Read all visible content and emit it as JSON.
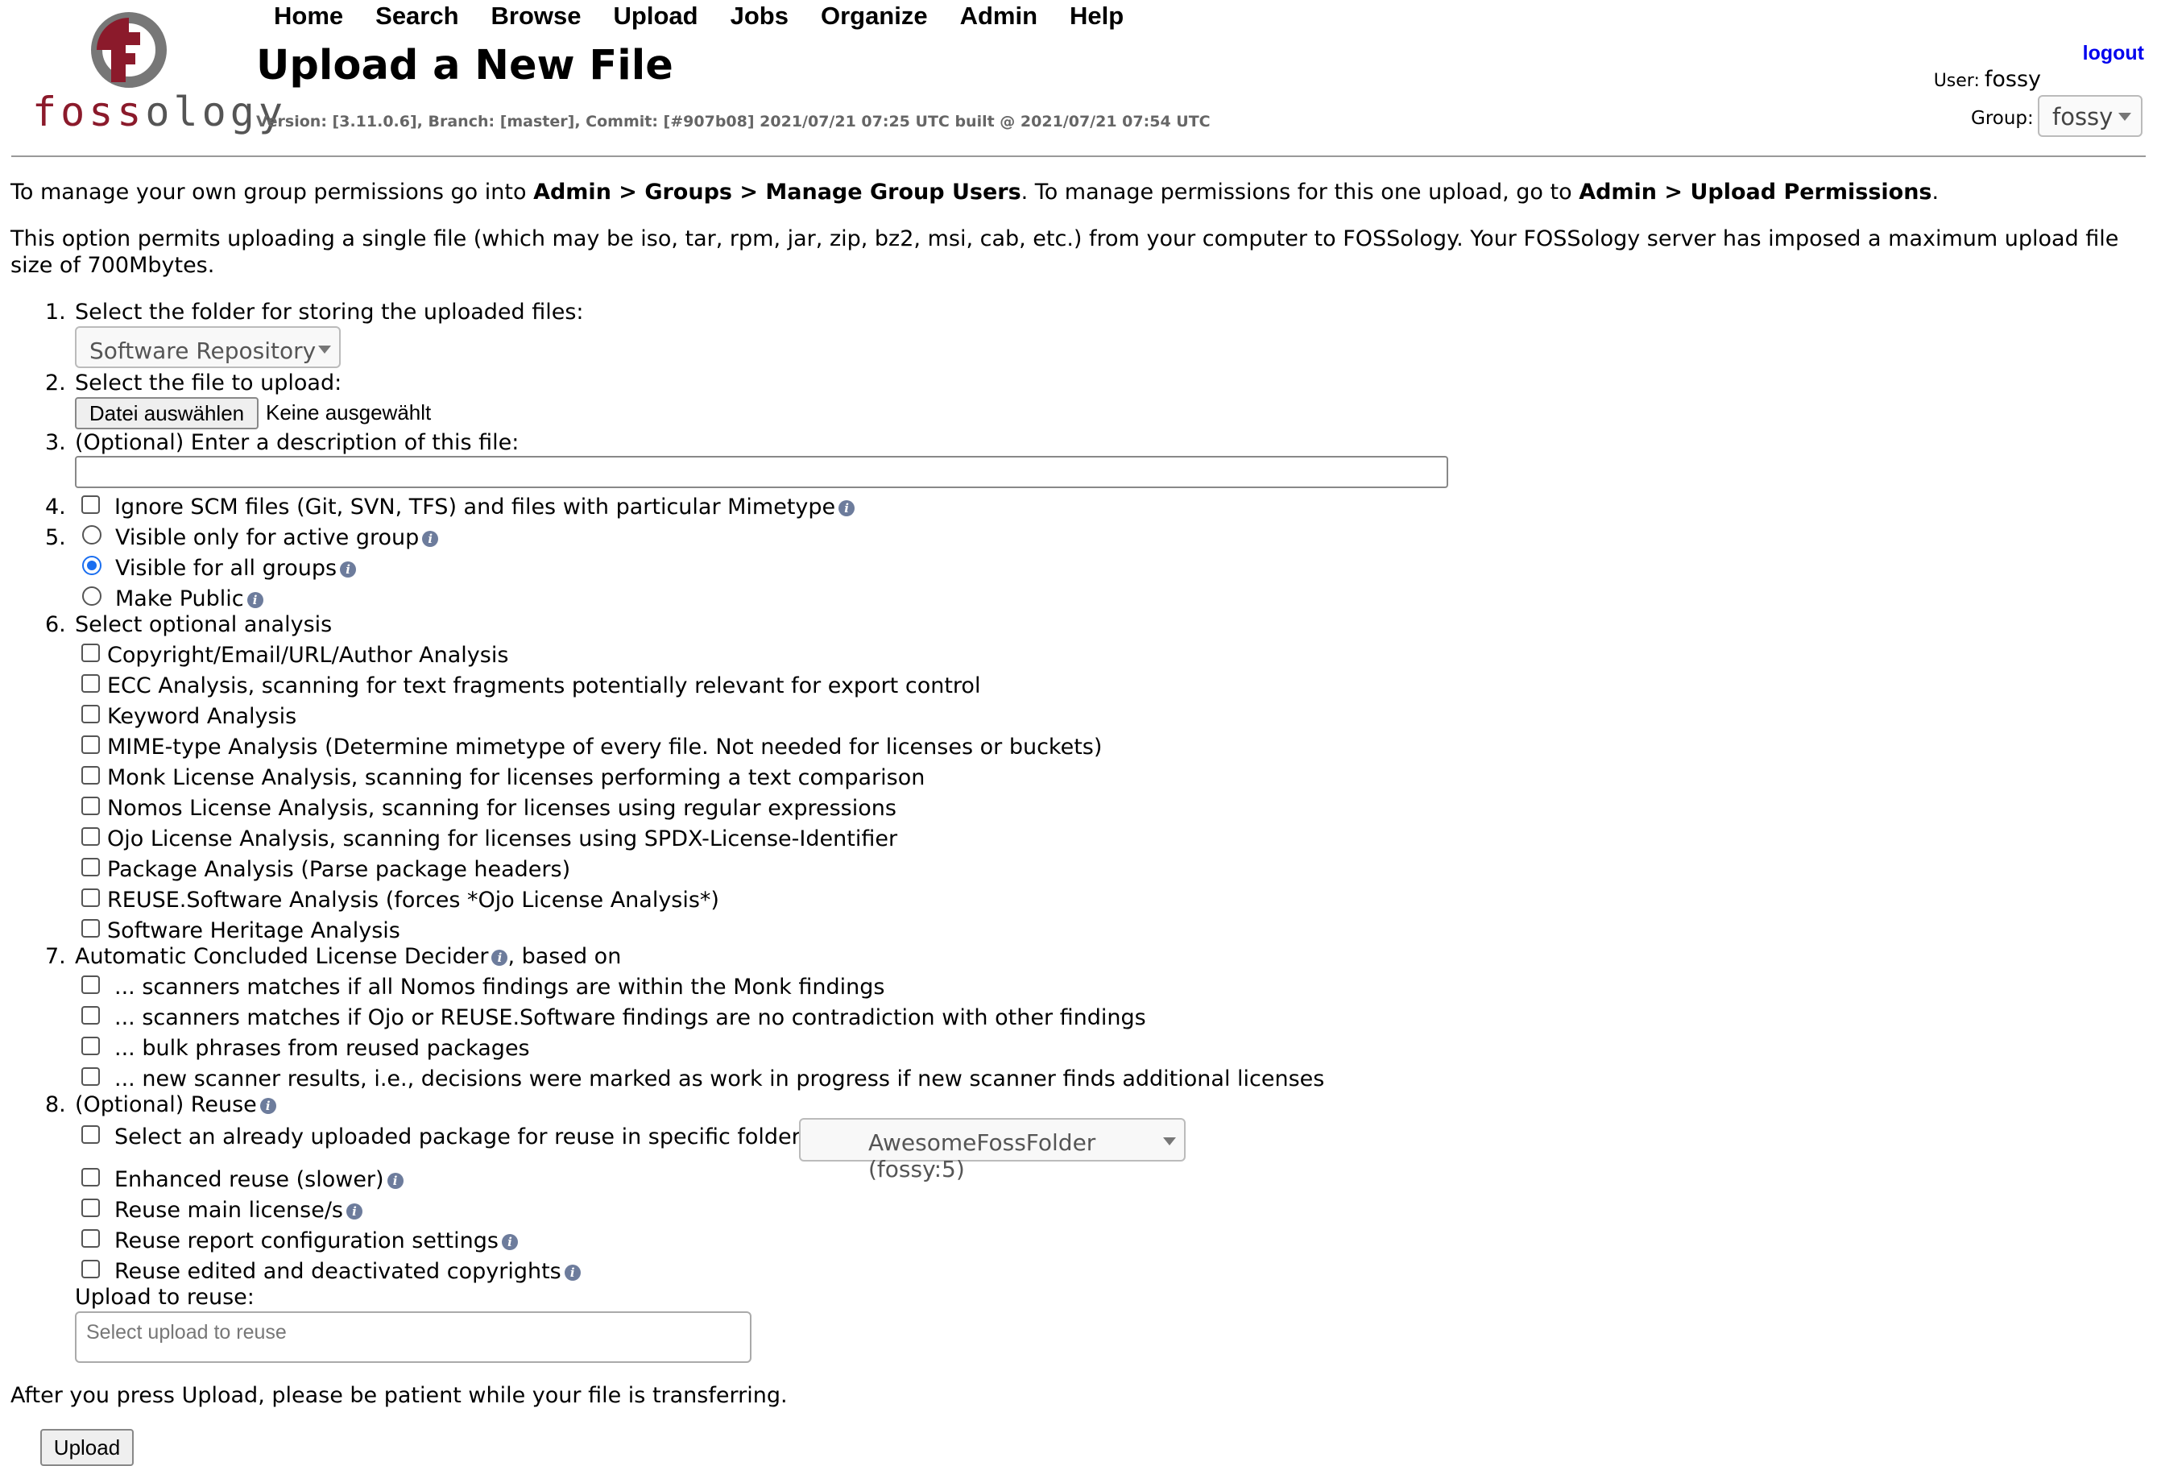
{
  "logo": {
    "text_red": "foss",
    "text_gray": "ology"
  },
  "nav": [
    "Home",
    "Search",
    "Browse",
    "Upload",
    "Jobs",
    "Organize",
    "Admin",
    "Help"
  ],
  "page_title": "Upload a New File",
  "version": "Version: [3.11.0.6], Branch: [master], Commit: [#907b08] 2021/07/21 07:25 UTC built @ 2021/07/21 07:54 UTC",
  "header": {
    "logout": "logout",
    "user_label": "User:",
    "user_name": "fossy",
    "group_label": "Group:",
    "group_value": "fossy"
  },
  "intro": {
    "p1_a": "To manage your own group permissions go into ",
    "p1_b": "Admin > Groups > Manage Group Users",
    "p1_c": ". To manage permissions for this one upload, go to ",
    "p1_d": "Admin > Upload Permissions",
    "p1_e": ".",
    "p2_line1": "This option permits uploading a single file (which may be iso, tar, rpm, jar, zip, bz2, msi, cab, etc.) from your computer to FOSSology. Your FOSSology server has imposed a maximum upload file",
    "p2_line2": "size of 700Mbytes."
  },
  "steps": {
    "s1_num": "1.",
    "s1_label": "Select the folder for storing the uploaded files:",
    "s1_folder": "Software Repository",
    "s2_num": "2.",
    "s2_label": "Select the file to upload:",
    "s2_button": "Datei auswählen",
    "s2_status": "Keine ausgewählt",
    "s3_num": "3.",
    "s3_label": "(Optional) Enter a description of this file:",
    "s3_value": "",
    "s4_num": "4.",
    "s4_label": "Ignore SCM files (Git, SVN, TFS) and files with particular Mimetype",
    "s5_num": "5.",
    "s5_opt1": "Visible only for active group",
    "s5_opt2": "Visible for all groups",
    "s5_opt3": "Make Public",
    "s5_selected": "Visible for all groups",
    "s6_num": "6.",
    "s6_label": "Select optional analysis",
    "s6_items": [
      "Copyright/Email/URL/Author Analysis",
      "ECC Analysis, scanning for text fragments potentially relevant for export control",
      "Keyword Analysis",
      "MIME-type Analysis (Determine mimetype of every file. Not needed for licenses or buckets)",
      "Monk License Analysis, scanning for licenses performing a text comparison",
      "Nomos License Analysis, scanning for licenses using regular expressions",
      "Ojo License Analysis, scanning for licenses using SPDX-License-Identifier",
      "Package Analysis (Parse package headers)",
      "REUSE.Software Analysis (forces *Ojo License Analysis*)",
      "Software Heritage Analysis"
    ],
    "s7_num": "7.",
    "s7_label_a": "Automatic Concluded License Decider",
    "s7_label_b": ", based on",
    "s7_items": [
      "... scanners matches if all Nomos findings are within the Monk findings",
      "... scanners matches if Ojo or REUSE.Software findings are no contradiction with other findings",
      "... bulk phrases from reused packages",
      "... new scanner results, i.e., decisions were marked as work in progress if new scanner finds additional licenses"
    ],
    "s8_num": "8.",
    "s8_label": "(Optional) Reuse",
    "s8_reuse_folder_label": "Select an already uploaded package for reuse in specific folder",
    "s8_reuse_folder": "AwesomeFossFolder (fossy:5)",
    "s8_enhanced": "Enhanced reuse (slower)",
    "s8_main": "Reuse main license/s",
    "s8_report": "Reuse report configuration settings",
    "s8_copyrights": "Reuse edited and deactivated copyrights",
    "s8_upload_label": "Upload to reuse:",
    "s8_upload_placeholder": "Select upload to reuse"
  },
  "footer_note": "After you press Upload, please be patient while your file is transferring.",
  "upload_button": "Upload",
  "colors": {
    "link": "#0000ee",
    "logo_red": "#8b1a2b",
    "info_icon": "#6d7c9c",
    "radio_selected": "#1a6ef0"
  }
}
